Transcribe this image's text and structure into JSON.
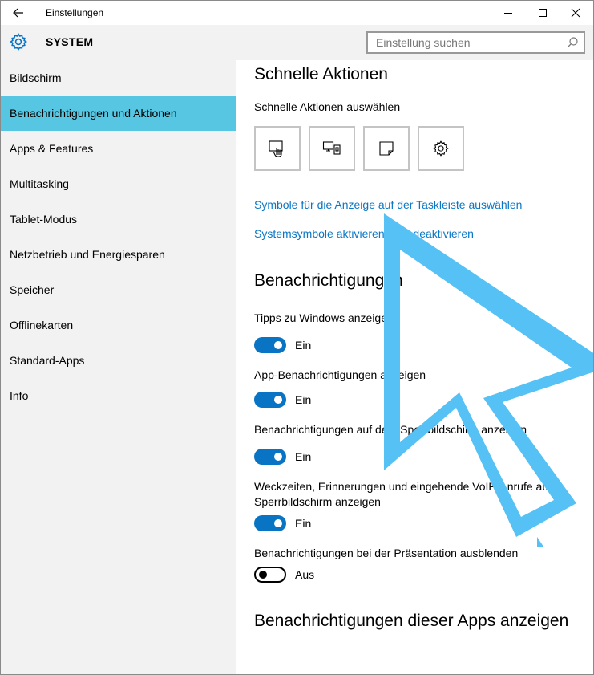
{
  "window": {
    "title": "Einstellungen"
  },
  "header": {
    "title": "SYSTEM",
    "search_placeholder": "Einstellung suchen"
  },
  "sidebar": {
    "items": [
      {
        "label": "Bildschirm"
      },
      {
        "label": "Benachrichtigungen und Aktionen",
        "selected": true
      },
      {
        "label": "Apps & Features"
      },
      {
        "label": "Multitasking"
      },
      {
        "label": "Tablet-Modus"
      },
      {
        "label": "Netzbetrieb und Energiesparen"
      },
      {
        "label": "Speicher"
      },
      {
        "label": "Offlinekarten"
      },
      {
        "label": "Standard-Apps"
      },
      {
        "label": "Info"
      }
    ]
  },
  "quick_actions": {
    "heading": "Schnelle Aktionen",
    "subheading": "Schnelle Aktionen auswählen",
    "tiles": [
      {
        "icon": "tablet-mode-icon"
      },
      {
        "icon": "project-icon"
      },
      {
        "icon": "note-icon"
      },
      {
        "icon": "settings-gear-icon"
      }
    ],
    "link_taskbar_icons": "Symbole für die Anzeige auf der Taskleiste auswählen",
    "link_system_icons": "Systemsymbole aktivieren oder deaktivieren"
  },
  "notifications": {
    "heading": "Benachrichtigungen",
    "settings": [
      {
        "label": "Tipps zu Windows anzeigen",
        "state": "Ein",
        "on": true
      },
      {
        "label": "App-Benachrichtigungen anzeigen",
        "state": "Ein",
        "on": true
      },
      {
        "label": "Benachrichtigungen auf dem Sperrbildschirm anzeigen",
        "state": "Ein",
        "on": true
      },
      {
        "label_line1": "Weckzeiten, Erinnerungen und eingehende VoIP-Anrufe auf",
        "label_line2": "Sperrbildschirm anzeigen",
        "state": "Ein",
        "on": true
      },
      {
        "label": "Benachrichtigungen bei der Präsentation ausblenden",
        "state": "Aus",
        "on": false
      }
    ]
  },
  "apps_section": {
    "heading": "Benachrichtigungen dieser Apps anzeigen"
  },
  "colors": {
    "accent": "#0a74c4",
    "selected_item": "#56c6e2",
    "link": "#0a77c6",
    "cursor_overlay": "#55c1f5"
  }
}
